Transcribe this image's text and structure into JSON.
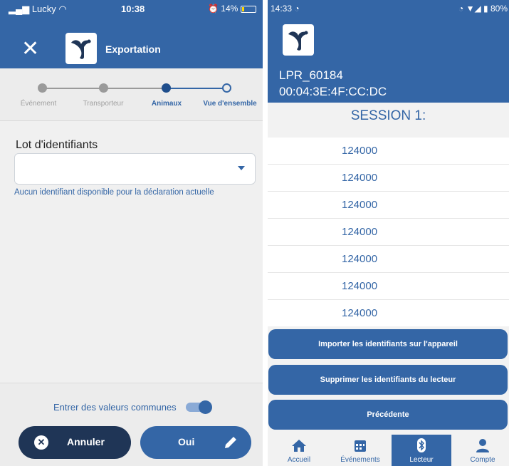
{
  "colors": {
    "brand": "#3466a6",
    "dark_button": "#1f3556",
    "background": "#f0f0f0",
    "battery_indicator": "#ffd600",
    "step_done": "#9a9a9a"
  },
  "left": {
    "status": {
      "carrier": "Lucky",
      "time": "10:38",
      "battery": "14%"
    },
    "title": "Exportation",
    "close_icon": "close-icon",
    "steps": [
      {
        "label": "Événement",
        "state": "done"
      },
      {
        "label": "Transporteur",
        "state": "done"
      },
      {
        "label": "Animaux",
        "state": "current"
      },
      {
        "label": "Vue d'ensemble",
        "state": "todo"
      }
    ],
    "field_label": "Lot d'identifiants",
    "select_value": "",
    "hint": "Aucun identifiant disponible pour la déclaration actuelle",
    "toggle_label": "Entrer des valeurs communes",
    "toggle_on": true,
    "cancel_label": "Annuler",
    "ok_label": "Oui"
  },
  "right": {
    "status": {
      "time": "14:33",
      "battery": "80%"
    },
    "device_name": "LPR_60184",
    "device_mac": "00:04:3E:4F:CC:DC",
    "session": "SESSION 1:",
    "ids": [
      "124000",
      "124000",
      "124000",
      "124000",
      "124000",
      "124000",
      "124000"
    ],
    "actions": [
      "Importer les identifiants sur l'appareil",
      "Supprimer les identifiants du lecteur",
      "Précédente"
    ],
    "nav": [
      {
        "label": "Accueil",
        "icon": "home-icon",
        "active": false
      },
      {
        "label": "Événements",
        "icon": "calendar-icon",
        "active": false
      },
      {
        "label": "Lecteur",
        "icon": "bluetooth-icon",
        "active": true
      },
      {
        "label": "Compte",
        "icon": "user-icon",
        "active": false
      }
    ]
  }
}
